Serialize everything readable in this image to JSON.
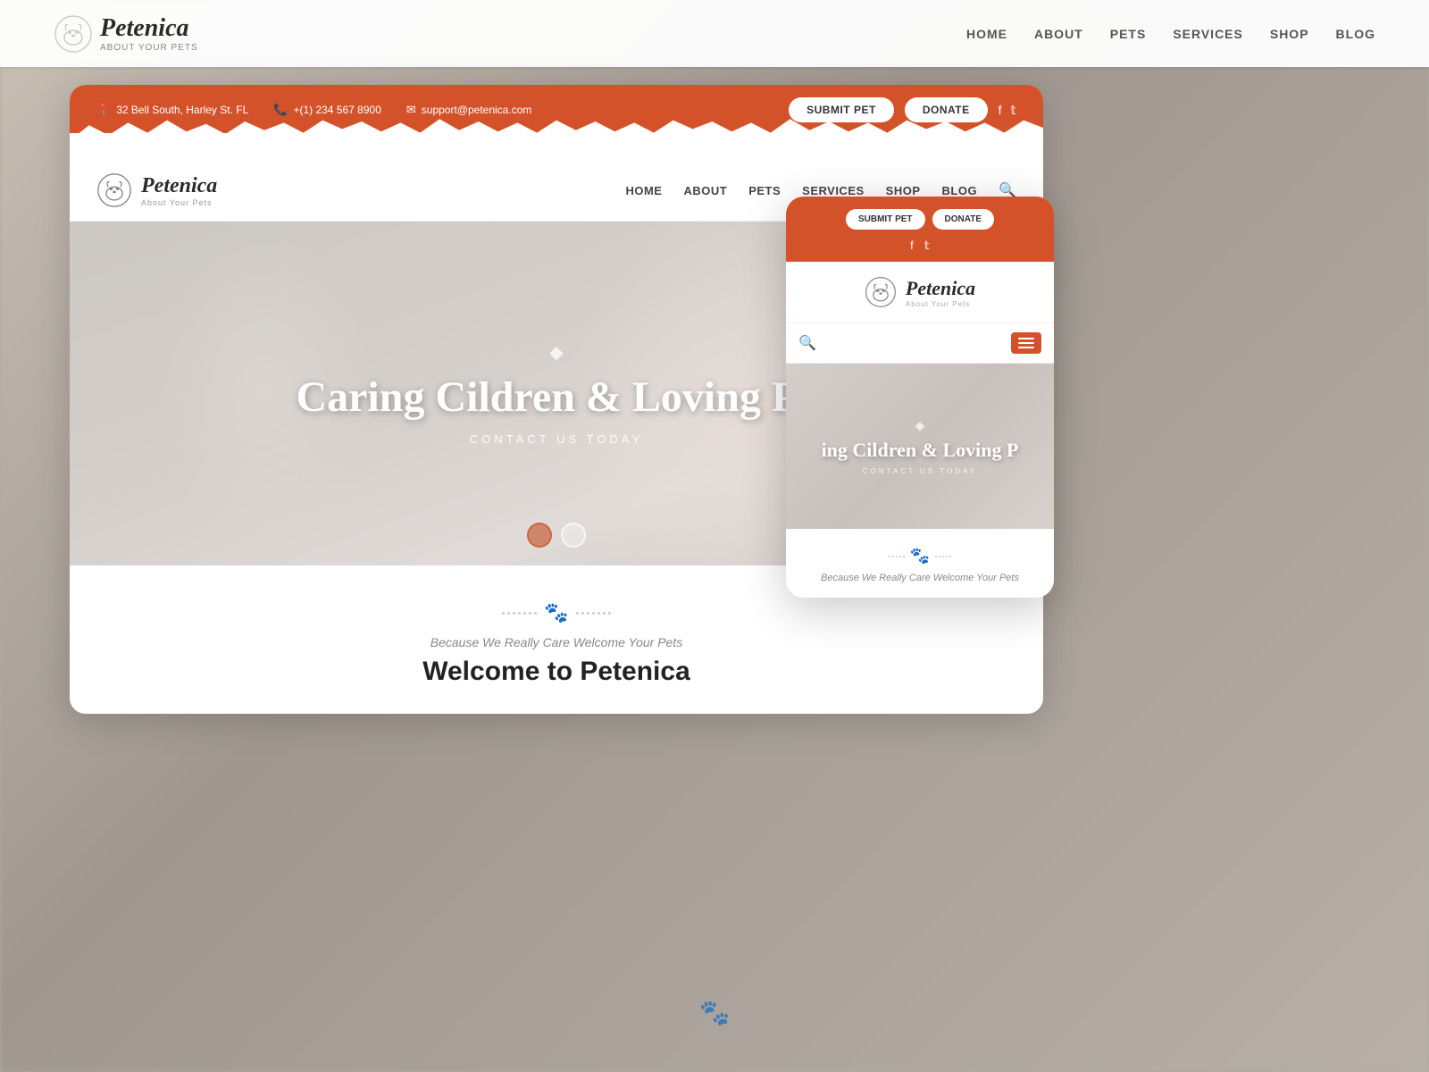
{
  "site": {
    "name": "Petenica",
    "tagline": "About Your Pets",
    "logo_sub": "About Your Pets"
  },
  "topbar": {
    "address": "32 Bell South, Harley St. FL",
    "phone": "+(1) 234 567 8900",
    "email": "support@petenica.com",
    "submit_btn": "SUBMIT PET",
    "donate_btn": "DONATE"
  },
  "nav": {
    "links": [
      "HOME",
      "ABOUT",
      "PETS",
      "SERVICES",
      "SHOP",
      "BLOG"
    ]
  },
  "hero": {
    "diamond": "◆",
    "title": "Caring Cildren & Loving Pe",
    "subtitle": "CONTACT US TODAY",
    "dots": [
      {
        "active": true
      },
      {
        "active": false
      }
    ]
  },
  "content": {
    "tagline": "Because We Really Care Welcome Your Pets",
    "title": "Welcome to Petenica",
    "paw": "🐾"
  },
  "mobile": {
    "submit_btn": "SUBMIT PET",
    "donate_btn": "DONATE",
    "hero_title": "ing Cildren & Loving P",
    "hero_subtitle": "CONTACT US TODAY",
    "tagline": "Because We Really Care Welcome Your Pets"
  },
  "background": {
    "nav_name": "Petenica",
    "nav_sub": "About Your Pets",
    "nav_links": [
      "HOME",
      "ABOUT",
      "PETS",
      "SERVICES",
      "SHOP",
      "BLOG"
    ]
  },
  "bottom": {
    "paw": "🐾"
  }
}
